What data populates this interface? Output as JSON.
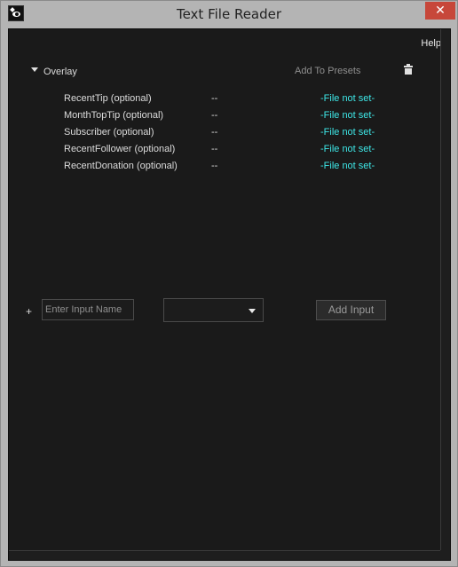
{
  "window": {
    "title": "Text File Reader",
    "close_symbol": "✕",
    "app_icon": "app-logo-icon"
  },
  "toolbar": {
    "help_label": "Help"
  },
  "section": {
    "name": "Overlay",
    "add_presets_label": "Add To Presets",
    "delete_icon": "trash-icon",
    "rows": [
      {
        "name": "RecentTip  (optional)",
        "value": "--",
        "file": "-File not set-"
      },
      {
        "name": "MonthTopTip  (optional)",
        "value": "--",
        "file": "-File not set-"
      },
      {
        "name": "Subscriber  (optional)",
        "value": "--",
        "file": "-File not set-"
      },
      {
        "name": "RecentFollower  (optional)",
        "value": "--",
        "file": "-File not set-"
      },
      {
        "name": "RecentDonation  (optional)",
        "value": "--",
        "file": "-File not set-"
      }
    ]
  },
  "add_row": {
    "plus_label": "+",
    "input_placeholder": "Enter Input Name",
    "input_value": "",
    "type_selected": "",
    "add_button_label": "Add Input"
  },
  "colors": {
    "accent_file_link": "#3ee8e8",
    "close_button": "#c7473a",
    "background": "#1a1a1a"
  }
}
